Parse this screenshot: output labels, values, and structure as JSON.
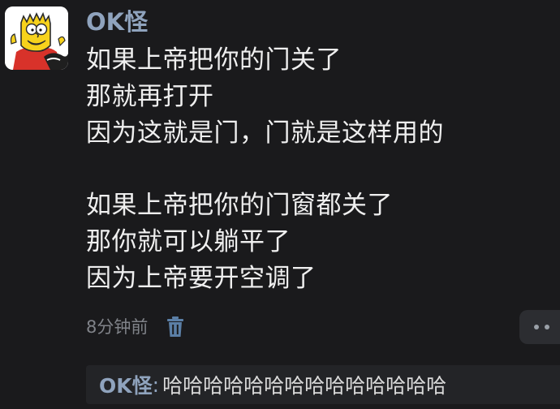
{
  "post": {
    "username": "OK怪",
    "avatar_icon": "bart-simpson-avatar-icon",
    "paragraphs": [
      {
        "lines": [
          "如果上帝把你的门关了",
          "那就再打开",
          "因为这就是门，门就是这样用的"
        ]
      },
      {
        "lines": [
          "如果上帝把你的门窗都关了",
          "那你就可以躺平了",
          "因为上帝要开空调了"
        ]
      }
    ],
    "timestamp": "8分钟前",
    "delete_icon": "trash-icon",
    "more_icon": "more-dots-icon"
  },
  "comments": [
    {
      "author": "OK怪",
      "separator": ":",
      "text": "哈哈哈哈哈哈哈哈哈哈哈哈哈哈"
    }
  ],
  "colors": {
    "background": "#1a1a1c",
    "username": "#8fa3bd",
    "body_text": "#efefef",
    "meta_text": "#808389",
    "comment_bg": "#232427",
    "more_button_bg": "#2c2d31"
  }
}
